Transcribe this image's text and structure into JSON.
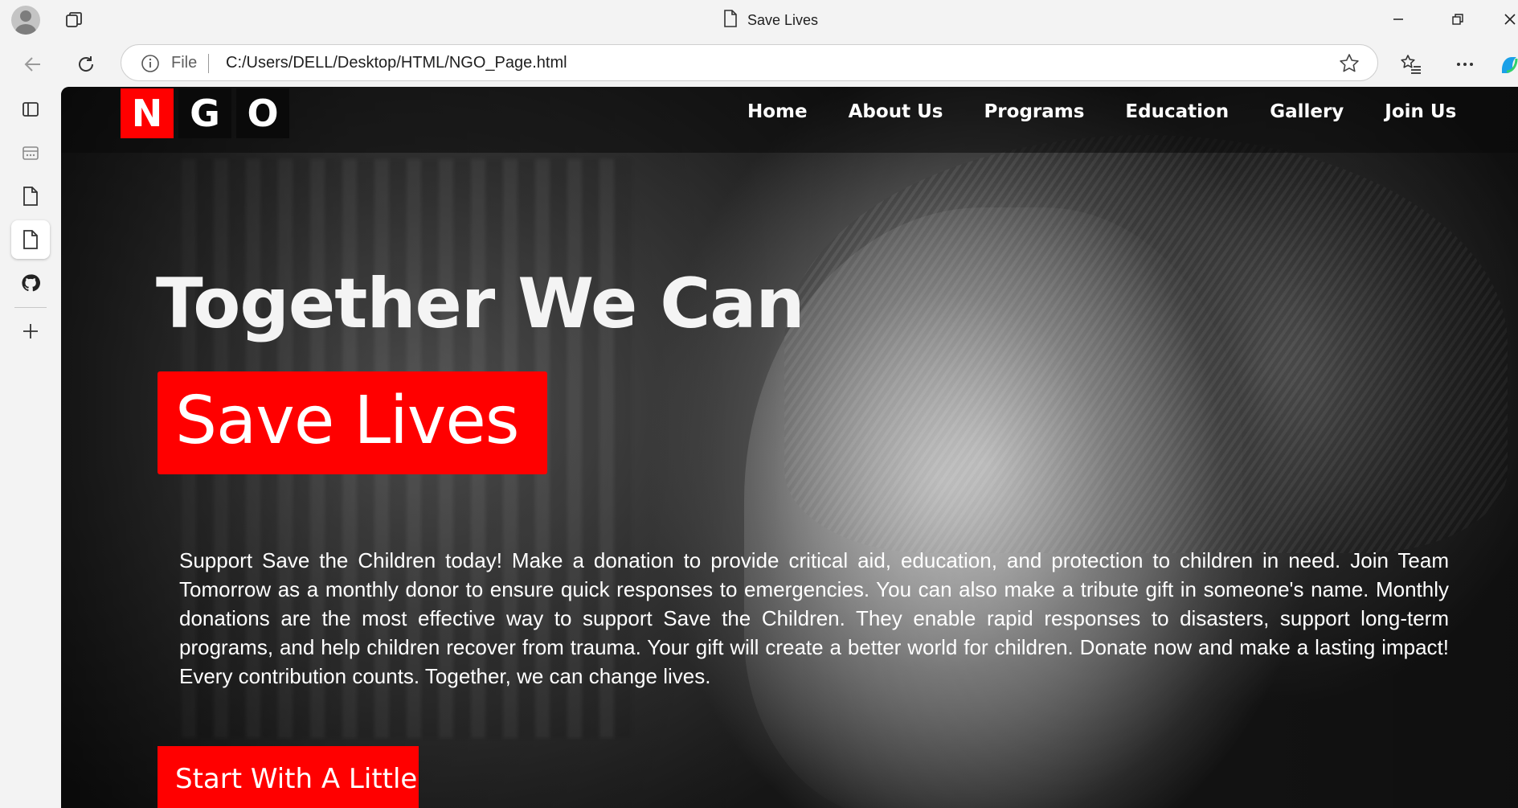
{
  "browser": {
    "tab_title": "Save Lives",
    "address": {
      "scheme_label": "File",
      "url": "C:/Users/DELL/Desktop/HTML/NGO_Page.html"
    }
  },
  "page": {
    "logo": [
      "N",
      "G",
      "O"
    ],
    "nav": [
      "Home",
      "About Us",
      "Programs",
      "Education",
      "Gallery",
      "Join Us"
    ],
    "hero": {
      "headline": "Together We Can",
      "highlight": "Save Lives",
      "description": "Support Save the Children today! Make a donation to provide critical aid, education, and protection to children in need. Join Team Tomorrow as a monthly donor to ensure quick responses to emergencies. You can also make a tribute gift in someone's name. Monthly donations are the most effective way to support Save the Children. They enable rapid responses to disasters, support long-term programs, and help children recover from trauma. Your gift will create a better world for children. Donate now and make a lasting impact! Every contribution counts. Together, we can change lives.",
      "cta_label": "Start With A Little"
    }
  },
  "colors": {
    "accent": "#ff0000",
    "navbar": "#0a0a0a",
    "text": "#ffffff"
  }
}
